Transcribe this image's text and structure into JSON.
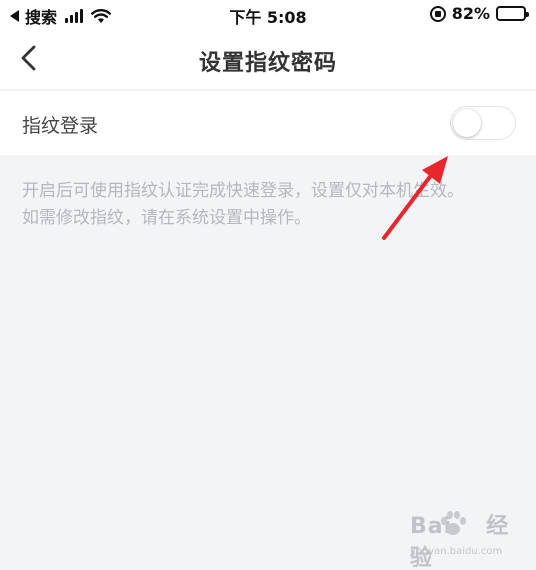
{
  "status_bar": {
    "carrier": "搜索",
    "time": "下午 5:08",
    "battery_percent": "82%",
    "battery_level": 0.82
  },
  "nav": {
    "title": "设置指纹密码",
    "back_icon": "chevron-left-icon"
  },
  "setting": {
    "label": "指纹登录",
    "toggle_on": false
  },
  "description": {
    "line1": "开启后可使用指纹认证完成快速登录，设置仅对本机生效。",
    "line2": "如需修改指纹，请在系统设置中操作。"
  },
  "annotation": {
    "arrow_color": "#e8262b"
  },
  "watermark": {
    "brand": "Bai",
    "brand_suffix": "经验",
    "url": "jingyan.baidu.com"
  }
}
